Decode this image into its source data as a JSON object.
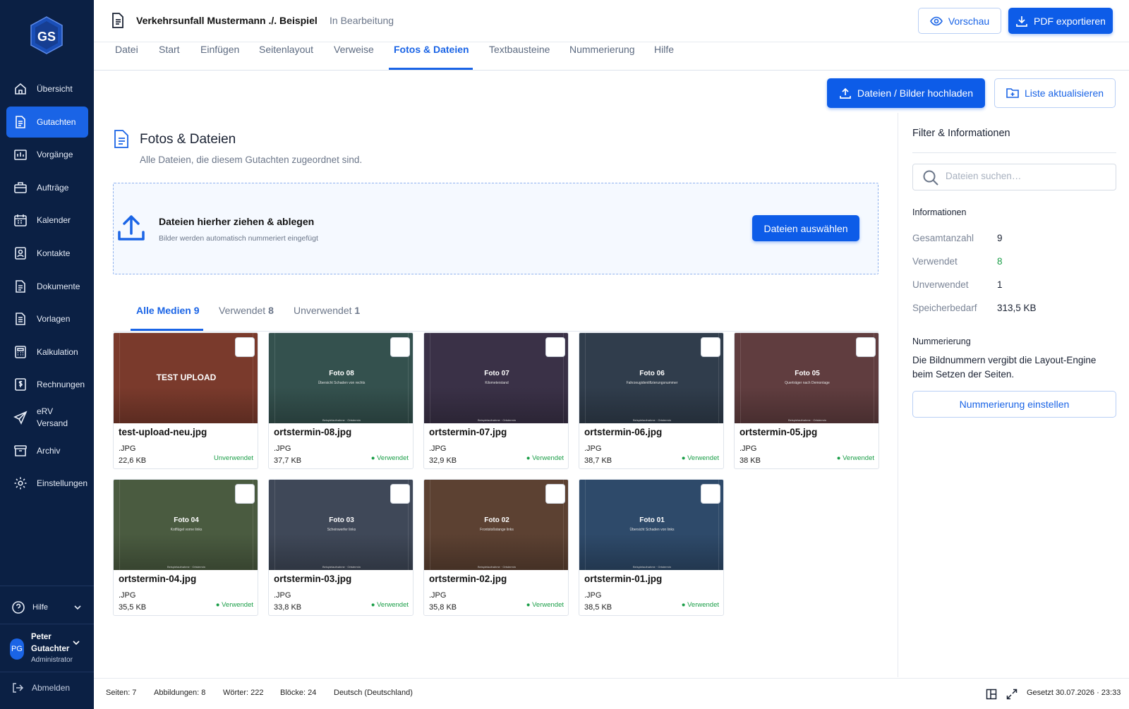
{
  "sidebar": {
    "logo_text": "GS",
    "items": [
      {
        "label": "Übersicht",
        "icon": "home-icon"
      },
      {
        "label": "Gutachten",
        "icon": "document-icon",
        "active": true
      },
      {
        "label": "Vorgänge",
        "icon": "chart-folder-icon"
      },
      {
        "label": "Aufträge",
        "icon": "briefcase-icon"
      },
      {
        "label": "Kalender",
        "icon": "calendar-icon"
      },
      {
        "label": "Kontakte",
        "icon": "contact-icon"
      },
      {
        "label": "Dokumente",
        "icon": "document-icon"
      },
      {
        "label": "Vorlagen",
        "icon": "template-icon"
      },
      {
        "label": "Kalkulation",
        "icon": "calculator-icon"
      },
      {
        "label": "Rechnungen",
        "icon": "invoice-icon"
      },
      {
        "label": "eRV Versand",
        "icon": "send-icon"
      },
      {
        "label": "Archiv",
        "icon": "archive-icon"
      },
      {
        "label": "Einstellungen",
        "icon": "gear-icon"
      }
    ],
    "help_label": "Hilfe",
    "user": {
      "initials": "PG",
      "name": "Peter Gutachter",
      "role": "Administrator"
    },
    "logout_label": "Abmelden"
  },
  "header": {
    "title": "Verkehrsunfall Mustermann ./. Beispiel",
    "status": "In Bearbeitung",
    "preview_label": "Vorschau",
    "export_label": "PDF exportieren"
  },
  "tabs": [
    "Datei",
    "Start",
    "Einfügen",
    "Seitenlayout",
    "Verweise",
    "Fotos & Dateien",
    "Textbausteine",
    "Nummerierung",
    "Hilfe"
  ],
  "active_tab": "Fotos & Dateien",
  "toolbar": {
    "upload_label": "Dateien / Bilder hochladen",
    "refresh_label": "Liste aktualisieren"
  },
  "section": {
    "title": "Fotos & Dateien",
    "subtitle": "Alle Dateien, die diesem Gutachten zugeordnet sind."
  },
  "dropzone": {
    "title": "Dateien hierher ziehen & ablegen",
    "subtitle": "Bilder werden automatisch nummeriert eingefügt",
    "button_label": "Dateien auswählen"
  },
  "media_tabs": [
    {
      "label": "Alle Medien",
      "count": "9"
    },
    {
      "label": "Verwendet",
      "count": "8"
    },
    {
      "label": "Unverwendet",
      "count": "1"
    }
  ],
  "files": [
    {
      "name": "test-upload-neu.jpg",
      "ext": ".JPG",
      "size": "22,6 KB",
      "status": "Unverwendet",
      "thumb_title": "TEST UPLOAD",
      "thumb_sub": "",
      "thumb_color": "#7a3a2c"
    },
    {
      "name": "ortstermin-08.jpg",
      "ext": ".JPG",
      "size": "37,7 KB",
      "status": "● Verwendet",
      "thumb_title": "Foto 08",
      "thumb_sub": "Übersicht Schaden von rechts",
      "thumb_color": "#34514e"
    },
    {
      "name": "ortstermin-07.jpg",
      "ext": ".JPG",
      "size": "32,9 KB",
      "status": "● Verwendet",
      "thumb_title": "Foto 07",
      "thumb_sub": "Kilometerstand",
      "thumb_color": "#3a3147"
    },
    {
      "name": "ortstermin-06.jpg",
      "ext": ".JPG",
      "size": "38,7 KB",
      "status": "● Verwendet",
      "thumb_title": "Foto 06",
      "thumb_sub": "Fahrzeugidentifizierungsnummer",
      "thumb_color": "#303d4c"
    },
    {
      "name": "ortstermin-05.jpg",
      "ext": ".JPG",
      "size": "38 KB",
      "status": "● Verwendet",
      "thumb_title": "Foto 05",
      "thumb_sub": "Querträger nach Demontage",
      "thumb_color": "#603d3f"
    },
    {
      "name": "ortstermin-04.jpg",
      "ext": ".JPG",
      "size": "35,5 KB",
      "status": "● Verwendet",
      "thumb_title": "Foto 04",
      "thumb_sub": "Kotflügel vorne links",
      "thumb_color": "#4a5b40"
    },
    {
      "name": "ortstermin-03.jpg",
      "ext": ".JPG",
      "size": "33,8 KB",
      "status": "● Verwendet",
      "thumb_title": "Foto 03",
      "thumb_sub": "Scheinwerfer links",
      "thumb_color": "#3f4858"
    },
    {
      "name": "ortstermin-02.jpg",
      "ext": ".JPG",
      "size": "35,8 KB",
      "status": "● Verwendet",
      "thumb_title": "Foto 02",
      "thumb_sub": "Frontstoßstange links",
      "thumb_color": "#5c4132"
    },
    {
      "name": "ortstermin-01.jpg",
      "ext": ".JPG",
      "size": "38,5 KB",
      "status": "● Verwendet",
      "thumb_title": "Foto 01",
      "thumb_sub": "Übersicht Schaden von links",
      "thumb_color": "#2e4a6a"
    }
  ],
  "thumb_footer": "Beispielaufnahme · Ortstermin",
  "panel": {
    "title": "Filter & Informationen",
    "search_placeholder": "Dateien suchen…",
    "info_heading": "Informationen",
    "stats": [
      {
        "label": "Gesamtanzahl",
        "value": "9"
      },
      {
        "label": "Verwendet",
        "value": "8"
      },
      {
        "label": "Unverwendet",
        "value": "1"
      },
      {
        "label": "Speicherbedarf",
        "value": "313,5 KB"
      }
    ],
    "numbering_heading": "Nummerierung",
    "numbering_text": "Die Bildnummern vergibt die Layout-Engine beim Setzen der Seiten.",
    "numbering_button": "Nummerierung einstellen"
  },
  "footer": {
    "pages": "Seiten: 7",
    "images": "Abbildungen: 8",
    "words": "Wörter: 222",
    "blocks": "Blöcke: 24",
    "language": "Deutsch (Deutschland)",
    "saved": "Gesetzt 30.07.2026 · 23:33"
  },
  "colors": {
    "accent": "#1a64e6",
    "sidebar": "#0b2044",
    "used": "#1b9e48"
  }
}
